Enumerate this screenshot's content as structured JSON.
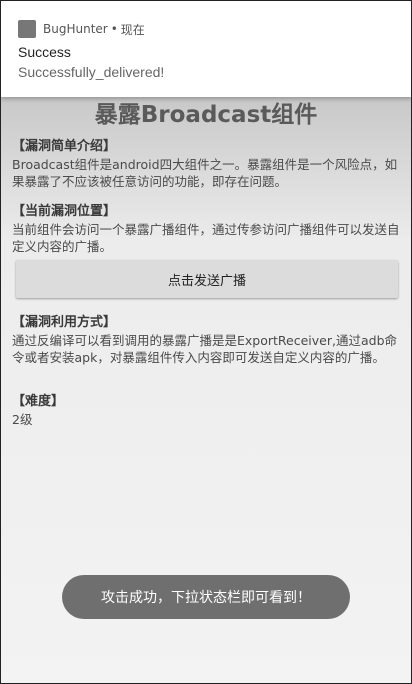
{
  "notification": {
    "app_name": "BugHunter",
    "separator": "•",
    "time": "现在",
    "title": "Success",
    "text": "Successfully_delivered!",
    "icon": "app-icon"
  },
  "page": {
    "title": "暴露Broadcast组件"
  },
  "sections": {
    "intro": {
      "heading": "【漏洞简单介绍】",
      "body": "Broadcast组件是android四大组件之一。暴露组件是一个风险点，如果暴露了不应该被任意访问的功能，即存在问题。"
    },
    "location": {
      "heading": "【当前漏洞位置】",
      "body": "当前组件会访问一个暴露广播组件，通过传参访问广播组件可以发送自定义内容的广播。"
    },
    "exploit": {
      "heading": "【漏洞利用方式】",
      "body": "通过反编译可以看到调用的暴露广播是是ExportReceiver,通过adb命令或者安装apk，对暴露组件传入内容即可发送自定义内容的广播。"
    },
    "difficulty": {
      "heading": "【难度】",
      "body": "2级"
    }
  },
  "actions": {
    "send_label": "点击发送广播"
  },
  "toast": {
    "text": "攻击成功，下拉状态栏即可看到！"
  }
}
